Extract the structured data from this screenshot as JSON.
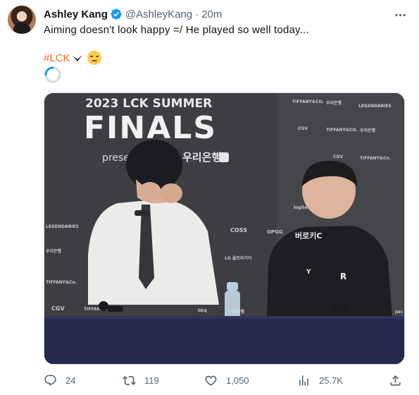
{
  "author": {
    "name": "Ashley Kang",
    "handle": "@AshleyKang",
    "separator": "·",
    "time": "20m",
    "verified": true
  },
  "tweet": {
    "text": "Aiming doesn't look happy =/ He played so well today...",
    "hashtag": "#LCK",
    "emoji": "pensive-face"
  },
  "media": {
    "backdrop_line1": "2023 LCK SUMMER",
    "backdrop_line2": "FINALS",
    "presenter_text": "presen",
    "sponsor_korean": "우리은행",
    "sponsor_small": [
      "TIFFANY&CO.",
      "우리은행",
      "LEGENDARIES",
      "CGV",
      "TIFFANY&CO.",
      "우리은행",
      "CGV",
      "TIFFANY&Co.",
      "logitech",
      "LEGENDARIES",
      "우리은행",
      "COSS",
      "OPGG",
      "LG 울트라기어",
      "TIFFANY&Co.",
      "CGV",
      "TIFFANY&Co.",
      "bbq",
      "우리은행",
      "jwc"
    ],
    "shirt_text": "버로키C"
  },
  "actions": {
    "replies": "24",
    "retweets": "119",
    "likes": "1,050",
    "views": "25.7K"
  },
  "colors": {
    "hashtag": "#f26b1f",
    "verified": "#1d9bf0",
    "muted": "#536471"
  }
}
